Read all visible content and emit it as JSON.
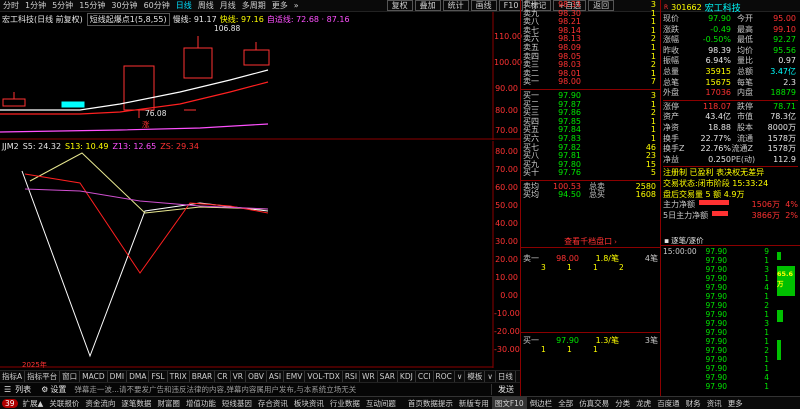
{
  "toolbar": {
    "periods": [
      "分时",
      "1分钟",
      "5分钟",
      "15分钟",
      "30分钟",
      "60分钟",
      "日线",
      "周线",
      "月线",
      "多周期",
      "更多"
    ],
    "active": "日线",
    "right_buttons": [
      "复权",
      "叠加",
      "统计",
      "画线",
      "F10",
      "标记",
      "+自选",
      "返回"
    ]
  },
  "price_header": {
    "stock_label": "宏工科技(日线 前复权)",
    "indicator": "短线起爆点1(5,8,55)",
    "ma1": "慢线: 91.17",
    "ma2": "快线: 97.16",
    "ma3": "自适线: 72.68 · 87.16"
  },
  "price_axis": [
    "110.00",
    "100.00",
    "90.00",
    "80.00",
    "70.00"
  ],
  "annotations": {
    "high": "106.88",
    "low": "76.08",
    "event": "涨"
  },
  "indicator_header": {
    "name": "JJM2",
    "s": "S5: 24.32",
    "s13": "S13: 10.49",
    "z13": "Z13: 12.65",
    "zs": "ZS: 29.34"
  },
  "ind_axis": [
    "80.00",
    "70.00",
    "60.00",
    "50.00",
    "40.00",
    "30.00",
    "20.00",
    "10.00",
    "0.00",
    "-10.00",
    "-20.00",
    "-30.00"
  ],
  "year_label": "2025年",
  "ind_tabs": [
    "指标A",
    "指标平台",
    "窗口",
    "MACD",
    "DMI",
    "DMA",
    "FSL",
    "TRIX",
    "BRAR",
    "CR",
    "VR",
    "OBV",
    "ASI",
    "EMV",
    "VOL-TDX",
    "RSI",
    "WR",
    "SAR",
    "KDJ",
    "CCI",
    "ROC",
    "∨",
    "模板",
    "∨",
    "日线"
  ],
  "cmd": {
    "list": "列表",
    "settings": "设置",
    "placeholder": "弹幕走一波...请不要发广告和违反法律的内容,弹幕内容属用户发布,与本系统立场无关",
    "send": "发送"
  },
  "bottom": [
    "扩展▲",
    "关联报价",
    "资金流向",
    "逐笔数据",
    "财富圈",
    "增值功能",
    "短线基因",
    "存合资讯",
    "板块资讯",
    "行业数据",
    "互动间题"
  ],
  "bottom_right": [
    "首页数据提示",
    "新版专用",
    "图文F10",
    "倒边栏",
    "全部",
    "仿真交易",
    "分类",
    "龙虎",
    "百度通",
    "财务",
    "资讯",
    "更多"
  ],
  "book": {
    "asks": [
      {
        "l": "卖十",
        "p": "98.33",
        "v": "3"
      },
      {
        "l": "卖九",
        "p": "98.30",
        "v": "1"
      },
      {
        "l": "卖八",
        "p": "98.21",
        "v": "1"
      },
      {
        "l": "卖七",
        "p": "98.14",
        "v": "1"
      },
      {
        "l": "卖六",
        "p": "98.13",
        "v": "2"
      },
      {
        "l": "卖五",
        "p": "98.09",
        "v": "1"
      },
      {
        "l": "卖四",
        "p": "98.05",
        "v": "1"
      },
      {
        "l": "卖三",
        "p": "98.03",
        "v": "2"
      },
      {
        "l": "卖二",
        "p": "98.01",
        "v": "1"
      },
      {
        "l": "卖一",
        "p": "98.00",
        "v": "7"
      }
    ],
    "bids": [
      {
        "l": "买一",
        "p": "97.90",
        "v": "3"
      },
      {
        "l": "买二",
        "p": "97.87",
        "v": "1"
      },
      {
        "l": "买三",
        "p": "97.86",
        "v": "2"
      },
      {
        "l": "买四",
        "p": "97.85",
        "v": "1"
      },
      {
        "l": "买五",
        "p": "97.84",
        "v": "1"
      },
      {
        "l": "买六",
        "p": "97.83",
        "v": "1"
      },
      {
        "l": "买七",
        "p": "97.82",
        "v": "46"
      },
      {
        "l": "买八",
        "p": "97.81",
        "v": "23"
      },
      {
        "l": "买九",
        "p": "97.80",
        "v": "15"
      },
      {
        "l": "买十",
        "p": "97.76",
        "v": "5"
      }
    ],
    "ask_avg_l": "卖均",
    "ask_avg": "100.53",
    "ask_total_l": "总卖",
    "ask_total": "2580",
    "bid_avg_l": "买均",
    "bid_avg": "94.50",
    "bid_total_l": "总买",
    "bid_total": "1608"
  },
  "info": {
    "code": "301662",
    "name": "宏工科技",
    "rows": [
      {
        "a": "现价",
        "b": "97.90",
        "c": "今开",
        "d": "95.00"
      },
      {
        "a": "涨跌",
        "b": "-0.49",
        "c": "最高",
        "d": "99.10"
      },
      {
        "a": "涨幅",
        "b": "-0.50%",
        "c": "最低",
        "d": "92.27"
      },
      {
        "a": "昨收",
        "b": "98.39",
        "c": "均价",
        "d": "95.56"
      },
      {
        "a": "振幅",
        "b": "6.94%",
        "c": "量比",
        "d": "0.97"
      },
      {
        "a": "总量",
        "b": "35915",
        "c": "总额",
        "d": "3.47亿"
      },
      {
        "a": "总笔",
        "b": "15675",
        "c": "每笔",
        "d": "2.3"
      },
      {
        "a": "外盘",
        "b": "17036",
        "c": "内盘",
        "d": "18879"
      },
      {
        "a": "涨停",
        "b": "118.07",
        "c": "跌停",
        "d": "78.71"
      },
      {
        "a": "资产",
        "b": "43.4亿",
        "c": "市值",
        "d": "78.3亿"
      },
      {
        "a": "净资",
        "b": "18.88",
        "c": "股本",
        "d": "8000万"
      },
      {
        "a": "换手",
        "b": "22.77%",
        "c": "流通",
        "d": "1578万"
      },
      {
        "a": "换手Z",
        "b": "22.76%",
        "c": "流通Z",
        "d": "1578万"
      },
      {
        "a": "净益",
        "b": "0.250",
        "c": "PE(动)",
        "d": "112.9"
      }
    ],
    "status1": "注册制 已盈利 表决权无差异",
    "status2": "交易状态:闭市阶段 15:33:24",
    "status3": "盘后交易量 5 额 4.9万",
    "flow1_l": "主力净额",
    "flow1": "1506万",
    "flow1_p": "4%",
    "flow2_l": "5日主力净额",
    "flow2": "3866万",
    "flow2_p": "2%"
  },
  "deep": {
    "title": "查看千档盘口",
    "ask_l": "卖一",
    "ask_p": "98.00",
    "ask_v": "1.8/笔",
    "ask_n": "4笔",
    "ask_q": [
      "3",
      "1",
      "1",
      "2"
    ],
    "bid_l": "买一",
    "bid_p": "97.90",
    "bid_v": "1.3/笔",
    "bid_n": "3笔",
    "bid_q": [
      "1",
      "1",
      "1"
    ]
  },
  "tape": {
    "title": "逐笔/逐价",
    "time": "15:00:00",
    "rows": [
      {
        "t": "15:00:00",
        "p": "97.90",
        "v": "9"
      },
      {
        "t": "",
        "p": "97.90",
        "v": "1"
      },
      {
        "t": "",
        "p": "97.90",
        "v": "3"
      },
      {
        "t": "",
        "p": "97.90",
        "v": "1"
      },
      {
        "t": "",
        "p": "97.90",
        "v": "4"
      },
      {
        "t": "",
        "p": "97.90",
        "v": "1"
      },
      {
        "t": "",
        "p": "97.90",
        "v": "2"
      },
      {
        "t": "",
        "p": "97.90",
        "v": "1"
      },
      {
        "t": "",
        "p": "97.90",
        "v": "3"
      },
      {
        "t": "",
        "p": "97.90",
        "v": "1"
      },
      {
        "t": "",
        "p": "97.90",
        "v": "1"
      },
      {
        "t": "",
        "p": "97.90",
        "v": "2"
      },
      {
        "t": "",
        "p": "97.90",
        "v": "1"
      },
      {
        "t": "",
        "p": "97.90",
        "v": "1"
      },
      {
        "t": "",
        "p": "97.90",
        "v": "4"
      },
      {
        "t": "",
        "p": "97.90",
        "v": "1"
      }
    ],
    "highlight": "65.6万"
  },
  "colors": {
    "up": "#ff3232",
    "down": "#00e600",
    "border": "#8b0000",
    "accent": "#00ffff"
  }
}
